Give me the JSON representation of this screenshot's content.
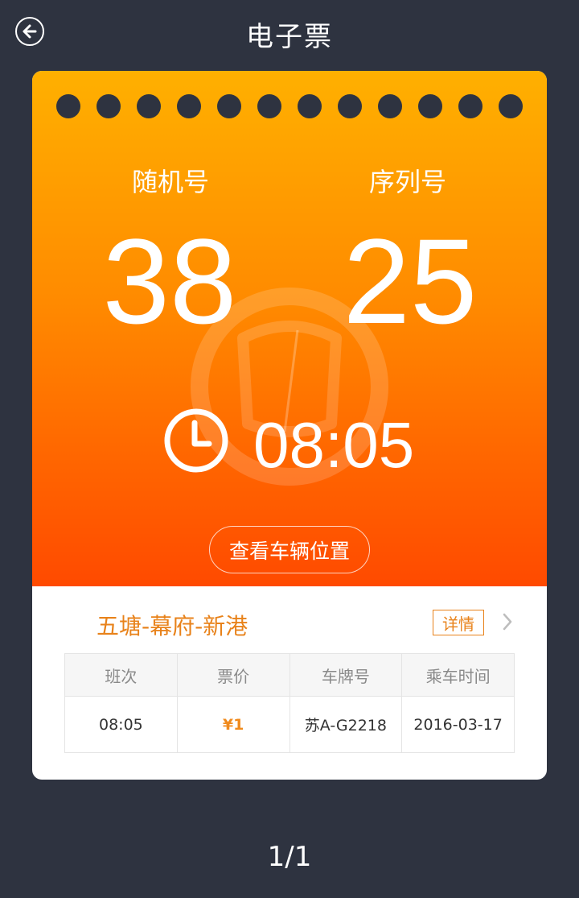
{
  "header": {
    "title": "电子票",
    "back_icon": "arrow-left-icon"
  },
  "ticket": {
    "random_label": "随机号",
    "random_value": "38",
    "serial_label": "序列号",
    "serial_value": "25",
    "time": "08:05",
    "clock_icon": "clock-icon",
    "watermark_icon": "bus-watermark-icon",
    "location_button": "查看车辆位置",
    "route": "五塘-幕府-新港",
    "detail_button": "详情",
    "table": {
      "headers": [
        "班次",
        "票价",
        "车牌号",
        "乘车时间"
      ],
      "values": [
        "08:05",
        "¥1",
        "苏A-G2218",
        "2016-03-17"
      ]
    }
  },
  "pager": "1/1",
  "colors": {
    "background": "#2e3340",
    "gradient_top": "#ffb000",
    "gradient_bottom": "#ff4a00",
    "accent": "#e8821a"
  }
}
